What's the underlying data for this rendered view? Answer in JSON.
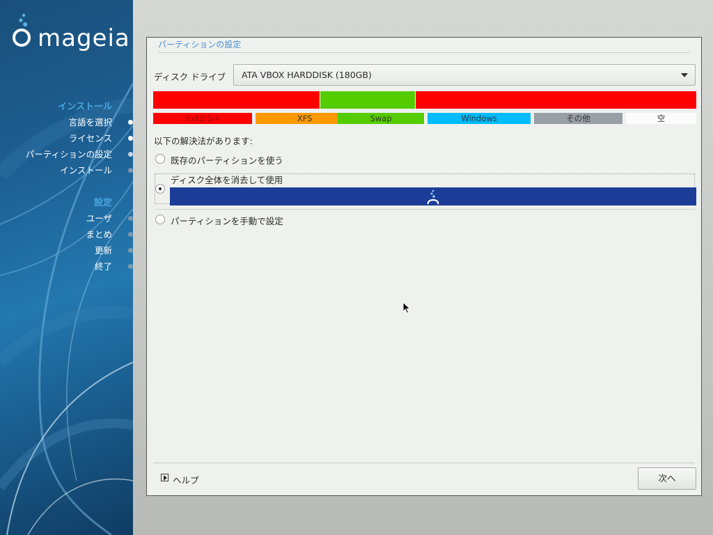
{
  "sidebar": {
    "brand": "mageia",
    "sections": [
      {
        "heading": "インストール",
        "items": [
          {
            "label": "言語を選択",
            "state": "done"
          },
          {
            "label": "ライセンス",
            "state": "done"
          },
          {
            "label": "パーティションの設定",
            "state": "current"
          },
          {
            "label": "インストール",
            "state": "pending"
          }
        ]
      },
      {
        "heading": "設定",
        "items": [
          {
            "label": "ユーザ",
            "state": "pending"
          },
          {
            "label": "まとめ",
            "state": "pending"
          },
          {
            "label": "更新",
            "state": "pending"
          },
          {
            "label": "終了",
            "state": "pending"
          }
        ]
      }
    ]
  },
  "window": {
    "title": "パーティションの設定",
    "disk_label": "ディスク ドライブ",
    "disk_value": "ATA VBOX HARDDISK (180GB)",
    "partitions": [
      {
        "type": "Ext2/3/4",
        "color": "#ff0000",
        "fraction": 0.307
      },
      {
        "type": "Swap",
        "color": "#55cc00",
        "fraction": 0.175
      },
      {
        "type": "Ext2/3/4",
        "color": "#ff0000",
        "fraction": 0.518
      }
    ],
    "legend": [
      {
        "label": "Ext2/3/4",
        "color": "#ff0000"
      },
      {
        "label": "XFS",
        "color": "#ff9900"
      },
      {
        "label": "Swap",
        "color": "#55cc00"
      },
      {
        "label": "Windows",
        "color": "#00bbff"
      },
      {
        "label": "その他",
        "color": "#999fa6"
      },
      {
        "label": "空",
        "color": "#fbfcfb"
      }
    ],
    "solutions_label": "以下の解決法があります:",
    "options": [
      {
        "label": "既存のパーティションを使う",
        "selected": false
      },
      {
        "label": "ディスク全体を消去して使用",
        "selected": true
      },
      {
        "label": "パーティションを手動で設定",
        "selected": false
      }
    ],
    "erase_bar_color": "#1c3d97",
    "help_label": "ヘルプ",
    "next_label": "次へ"
  }
}
